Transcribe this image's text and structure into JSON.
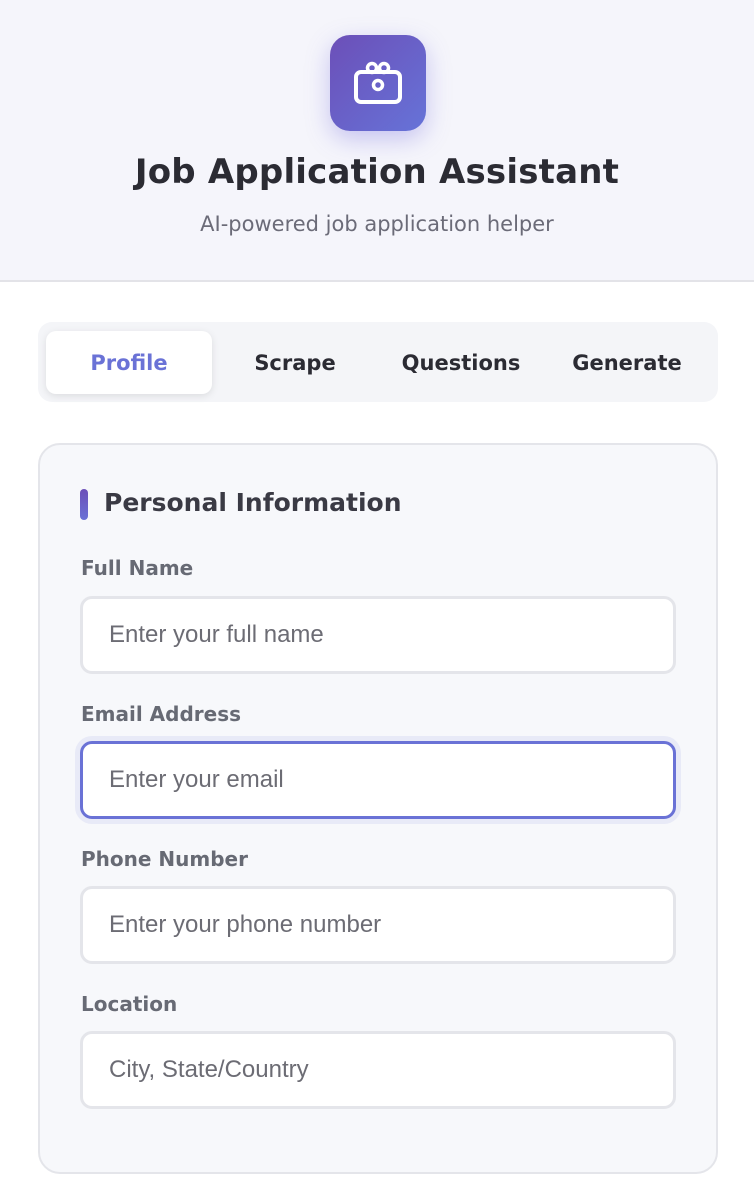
{
  "header": {
    "title": "Job Application Assistant",
    "subtitle": "AI-powered job application helper",
    "logo_icon": "briefcase-icon"
  },
  "tabs": [
    {
      "label": "Profile",
      "active": true
    },
    {
      "label": "Scrape",
      "active": false
    },
    {
      "label": "Questions",
      "active": false
    },
    {
      "label": "Generate",
      "active": false
    }
  ],
  "section": {
    "title": "Personal Information"
  },
  "fields": {
    "full_name": {
      "label": "Full Name",
      "value": "",
      "placeholder": "Enter your full name"
    },
    "email": {
      "label": "Email Address",
      "value": "",
      "placeholder": "Enter your email"
    },
    "phone": {
      "label": "Phone Number",
      "value": "",
      "placeholder": "Enter your phone number"
    },
    "location": {
      "label": "Location",
      "value": "",
      "placeholder": "City, State/Country"
    }
  },
  "colors": {
    "accent": "#6a72d6",
    "accent_dark": "#6c4fb8",
    "header_bg": "#f5f5fb",
    "card_bg": "#f7f8fb"
  }
}
